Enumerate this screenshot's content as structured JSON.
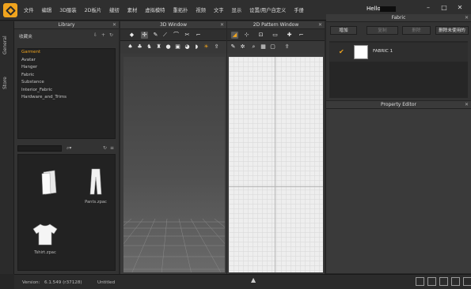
{
  "menubar": {
    "items": [
      "文件",
      "编辑",
      "3D服装",
      "2D板片",
      "缝纫",
      "素材",
      "虚拟模特",
      "重拓扑",
      "视频",
      "文字",
      "显示",
      "设置/用户自定义",
      "手册"
    ],
    "user": "Hello"
  },
  "side_tabs": [
    "General",
    "Store"
  ],
  "library": {
    "title": "Library",
    "favorites_label": "收藏夹",
    "tree": [
      "Garment",
      "Avatar",
      "Hanger",
      "Fabric",
      "Substance",
      "Interior_Fabric",
      "Hardware_and_Trims"
    ],
    "files": [
      {
        "name": ""
      },
      {
        "name": "Pants.zpac"
      },
      {
        "name": "Tshirt.zpac"
      }
    ]
  },
  "window3d": {
    "title": "3D Window"
  },
  "window2d": {
    "title": "2D Pattern Window"
  },
  "fabric": {
    "title": "Fabric",
    "buttons": [
      "增加",
      "复制",
      "删除",
      "删除未使用的"
    ],
    "items": [
      {
        "name": "FABRIC 1",
        "color": "#ffffff"
      }
    ]
  },
  "property_editor": {
    "title": "Property Editor"
  },
  "status": {
    "version_label": "Version:",
    "version": "6.1.549 (r37128)",
    "document": "Untitled"
  },
  "colors": {
    "accent": "#f0a41e"
  }
}
